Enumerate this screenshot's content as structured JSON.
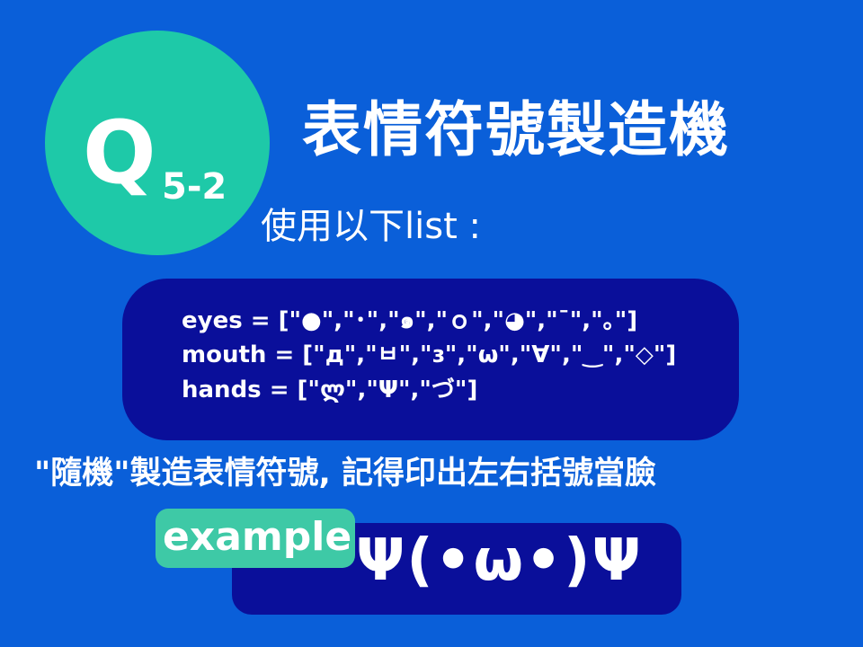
{
  "badge": {
    "letter": "Q",
    "number": "5-2"
  },
  "title": "表情符號製造機",
  "subtitle": "使用以下list :",
  "code": {
    "eyes": "eyes = [\"●\",\"･\",\"๑\",\"ｏ\",\"◕\",\"¯\",\"｡\"]",
    "mouth": "mouth = [\"д\",\"ㅂ\",\"ɜ\",\"ω\",\"∀\",\"‿\",\"◇\"]",
    "hands": "hands = [\"ლ\",\"Ψ\",\"づ\"]"
  },
  "instruction": "\"隨機\"製造表情符號, 記得印出左右括號當臉",
  "example": {
    "label": "example",
    "face": "Ψ(•ω•)Ψ"
  },
  "colors": {
    "background": "#0a5fd9",
    "badge": "#1ec9a8",
    "code_box": "#0a0f9a",
    "example_tag": "#3ec9a6"
  }
}
